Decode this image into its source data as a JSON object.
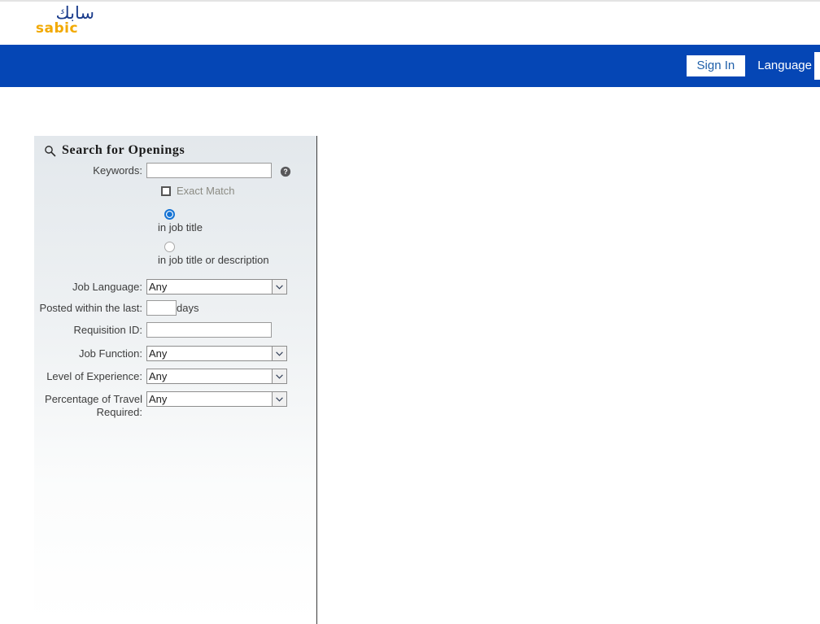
{
  "brand": {
    "logo_arabic": "سابك",
    "logo_latin": "sabic",
    "logo_blue": "#1b3d8c",
    "logo_gold": "#f2a900"
  },
  "nav": {
    "bar_color": "#0546b5",
    "sign_in_label": "Sign In",
    "language_label": "Language"
  },
  "search_panel": {
    "title": "Search for Openings",
    "search_icon": "magnifier-icon",
    "help_icon": "help-question-icon",
    "fields": {
      "keywords": {
        "label": "Keywords:",
        "value": "",
        "placeholder": ""
      },
      "exact_match": {
        "label": "Exact Match",
        "checked": false
      },
      "scope": {
        "options": [
          {
            "label": "in job title",
            "selected": true
          },
          {
            "label": "in job title or description",
            "selected": false
          }
        ]
      },
      "job_language": {
        "label": "Job Language:",
        "value": "Any",
        "options": [
          "Any"
        ]
      },
      "posted_within": {
        "label": "Posted within the last:",
        "value": "",
        "placeholder": "",
        "suffix": "days"
      },
      "requisition_id": {
        "label": "Requisition ID:",
        "value": "",
        "placeholder": ""
      },
      "job_function": {
        "label": "Job Function:",
        "value": "Any",
        "options": [
          "Any"
        ]
      },
      "level_of_experience": {
        "label": "Level of Experience:",
        "value": "Any",
        "options": [
          "Any"
        ]
      },
      "percentage_of_travel": {
        "label": "Percentage of Travel Required:",
        "value": "Any",
        "options": [
          "Any"
        ]
      }
    }
  }
}
